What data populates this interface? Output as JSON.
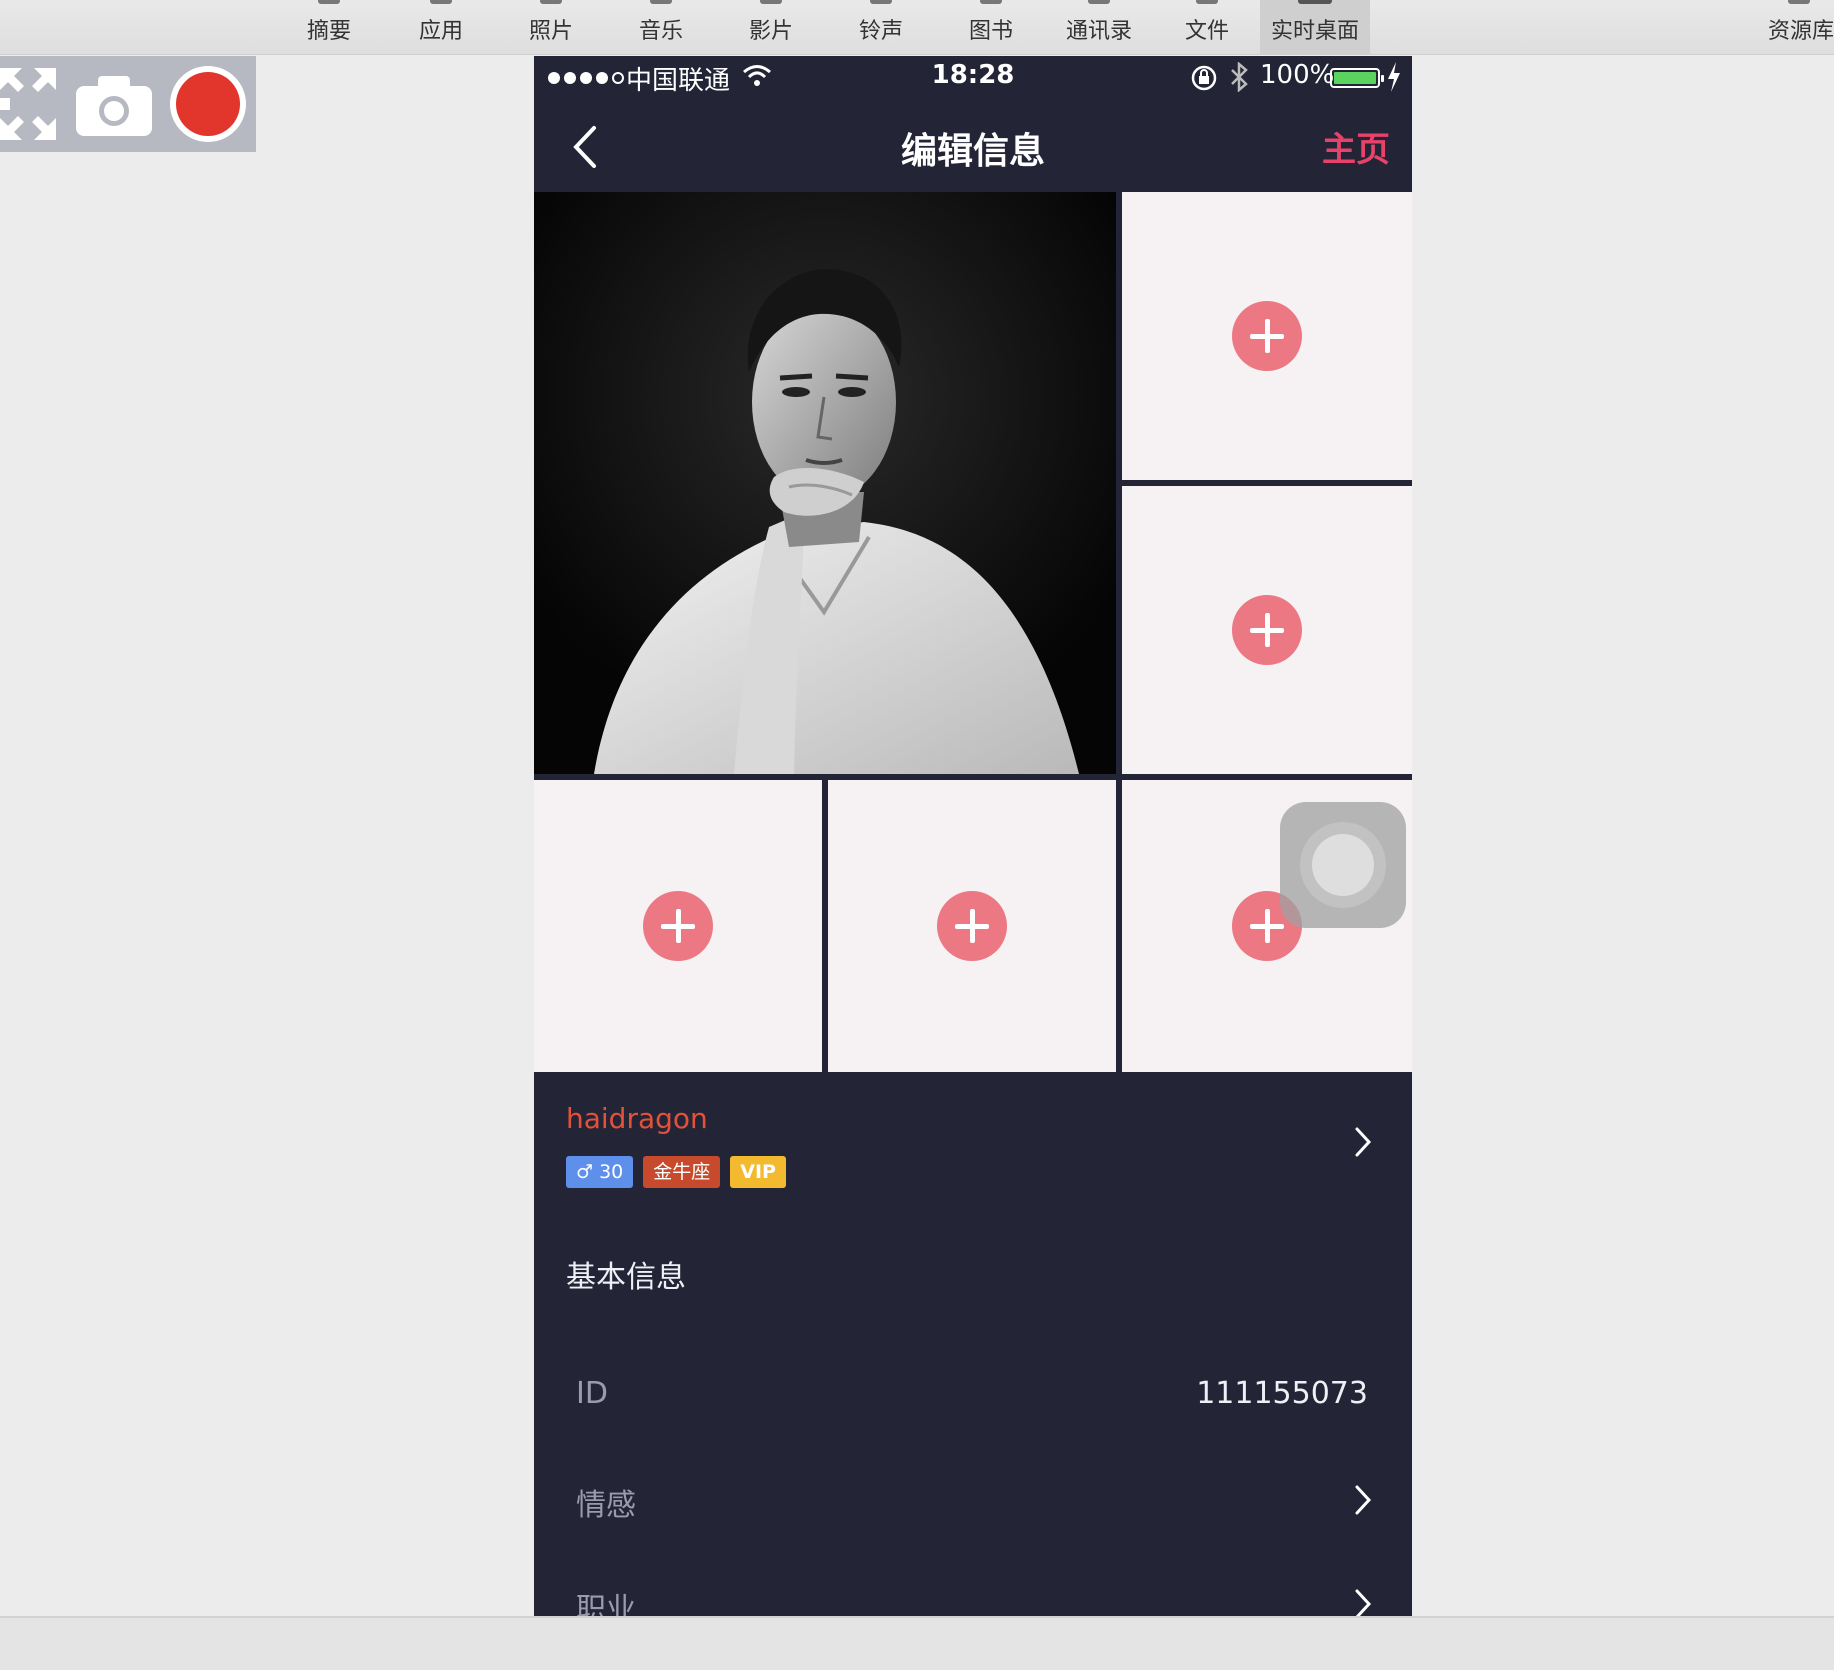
{
  "app_toolbar": {
    "items": [
      {
        "label": "摘要"
      },
      {
        "label": "应用"
      },
      {
        "label": "照片"
      },
      {
        "label": "音乐"
      },
      {
        "label": "影片"
      },
      {
        "label": "铃声"
      },
      {
        "label": "图书"
      },
      {
        "label": "通讯录"
      },
      {
        "label": "文件"
      },
      {
        "label": "实时桌面"
      },
      {
        "label": "资源库"
      }
    ],
    "active": "实时桌面"
  },
  "capture_toolbar": {
    "icons": [
      "expand-arrows-icon",
      "camera-icon",
      "record-icon"
    ]
  },
  "status_bar": {
    "carrier": "中国联通",
    "time": "18:28",
    "battery": "100%",
    "signal_bars_filled": 4,
    "signal_bars_total": 5
  },
  "nav": {
    "title": "编辑信息",
    "home_label": "主页",
    "back_icon": "chevron-left-icon"
  },
  "photos": {
    "add_icon": "plus-circle-icon",
    "accent": "#eb7883"
  },
  "profile": {
    "username": "haidragon",
    "gender_age": "♂ 30",
    "zodiac": "金牛座",
    "vip": "VIP"
  },
  "basic_info": {
    "title": "基本信息",
    "rows": [
      {
        "label": "ID",
        "value": "111155073"
      },
      {
        "label": "情感",
        "value": ""
      },
      {
        "label": "职业",
        "value": ""
      }
    ]
  },
  "colors": {
    "phone_bg": "#232536",
    "home_link": "#e8426a",
    "username": "#e4513a",
    "tag_gender": "#5e8fea",
    "tag_zodiac": "#c84a2c",
    "tag_vip": "#f3ba2f"
  }
}
